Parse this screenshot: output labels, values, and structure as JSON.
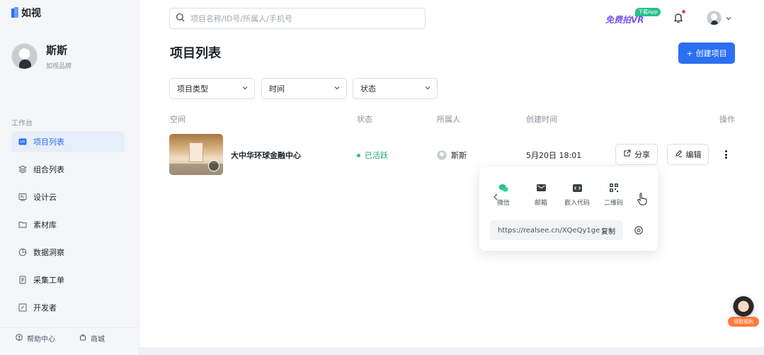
{
  "app": {
    "name": "如视"
  },
  "profile": {
    "name": "斯斯",
    "subtitle": "如视品牌"
  },
  "sidebar": {
    "section_label": "工作台",
    "items": [
      {
        "label": "项目列表",
        "icon": "vr-icon",
        "active": true
      },
      {
        "label": "组合列表",
        "icon": "layers-icon",
        "active": false
      },
      {
        "label": "设计云",
        "icon": "design-icon",
        "active": false
      },
      {
        "label": "素材库",
        "icon": "folder-icon",
        "active": false
      },
      {
        "label": "数据洞察",
        "icon": "pie-chart-icon",
        "active": false
      },
      {
        "label": "采集工单",
        "icon": "document-icon",
        "active": false
      },
      {
        "label": "开发者",
        "icon": "code-icon",
        "active": false
      }
    ],
    "footer": {
      "help": "帮助中心",
      "store": "商城"
    }
  },
  "header": {
    "search_placeholder": "项目名称/ID号/所属人/手机号",
    "vr_promo": "免费拍VR",
    "vr_download": "下载App"
  },
  "page": {
    "title": "项目列表",
    "create_button": "创建项目"
  },
  "filters": {
    "type": "项目类型",
    "time": "时间",
    "status": "状态"
  },
  "table": {
    "headers": {
      "space": "空间",
      "status": "状态",
      "owner": "所属人",
      "created": "创建时间",
      "actions": "操作"
    },
    "rows": [
      {
        "name": "大中华环球金融中心",
        "status": "已活跃",
        "owner": "斯斯",
        "created": "5月20日 18:01",
        "share": "分享",
        "edit": "编辑"
      }
    ]
  },
  "share_popover": {
    "options": [
      {
        "label": "微信",
        "icon": "wechat-icon"
      },
      {
        "label": "邮箱",
        "icon": "mail-icon"
      },
      {
        "label": "嵌入代码",
        "icon": "embed-code-icon"
      },
      {
        "label": "二维码",
        "icon": "qr-code-icon"
      }
    ],
    "link": "https://realsee.cn/XQeQy1ge",
    "copy": "复制"
  },
  "helper": {
    "tag": "领取福利"
  },
  "colors": {
    "accent": "#2b6ff3",
    "success": "#27c18a",
    "promo": "#7b55f0"
  }
}
